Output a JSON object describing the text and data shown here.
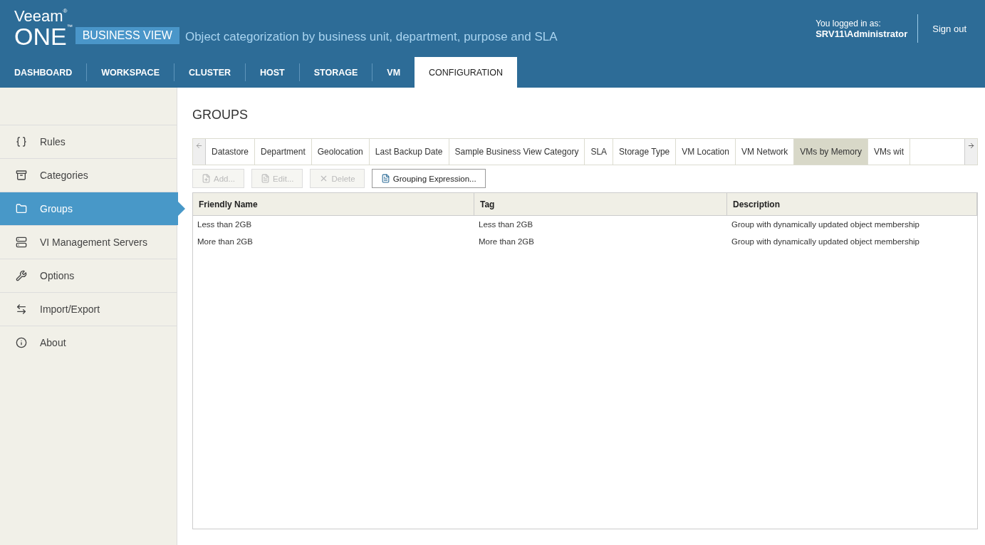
{
  "header": {
    "logo_top": "Veeam",
    "logo_reg": "®",
    "logo_main": "ONE",
    "logo_tm": "™",
    "product": "BUSINESS VIEW",
    "tagline": "Object categorization by business unit, department, purpose and SLA",
    "login_label": "You logged in as:",
    "login_user": "SRV11\\Administrator",
    "sign_out": "Sign out"
  },
  "nav": [
    {
      "label": "DASHBOARD",
      "selected": false
    },
    {
      "label": "WORKSPACE",
      "selected": false
    },
    {
      "label": "CLUSTER",
      "selected": false
    },
    {
      "label": "HOST",
      "selected": false
    },
    {
      "label": "STORAGE",
      "selected": false
    },
    {
      "label": "VM",
      "selected": false
    },
    {
      "label": "CONFIGURATION",
      "selected": true
    }
  ],
  "sidebar": {
    "items": [
      {
        "label": "Rules",
        "selected": false
      },
      {
        "label": "Categories",
        "selected": false
      },
      {
        "label": "Groups",
        "selected": true
      },
      {
        "label": "VI Management Servers",
        "selected": false
      },
      {
        "label": "Options",
        "selected": false
      },
      {
        "label": "Import/Export",
        "selected": false
      },
      {
        "label": "About",
        "selected": false
      }
    ]
  },
  "page_title": "GROUPS",
  "category_tabs": [
    {
      "label": "Datastore",
      "selected": false
    },
    {
      "label": "Department",
      "selected": false
    },
    {
      "label": "Geolocation",
      "selected": false
    },
    {
      "label": "Last Backup Date",
      "selected": false
    },
    {
      "label": "Sample Business View Category",
      "selected": false
    },
    {
      "label": "SLA",
      "selected": false
    },
    {
      "label": "Storage Type",
      "selected": false
    },
    {
      "label": "VM Location",
      "selected": false
    },
    {
      "label": "VM Network",
      "selected": false
    },
    {
      "label": "VMs by Memory",
      "selected": true
    },
    {
      "label": "VMs wit",
      "selected": false
    }
  ],
  "toolbar": [
    {
      "label": "Add...",
      "disabled": true
    },
    {
      "label": "Edit...",
      "disabled": true
    },
    {
      "label": "Delete",
      "disabled": true
    },
    {
      "label": "Grouping Expression...",
      "disabled": false
    }
  ],
  "table": {
    "columns": [
      "Friendly Name",
      "Tag",
      "Description"
    ],
    "rows": [
      [
        "Less than 2GB",
        "Less than 2GB",
        "Group with dynamically updated object membership"
      ],
      [
        "More than 2GB",
        "More than 2GB",
        "Group with dynamically updated object membership"
      ]
    ]
  }
}
